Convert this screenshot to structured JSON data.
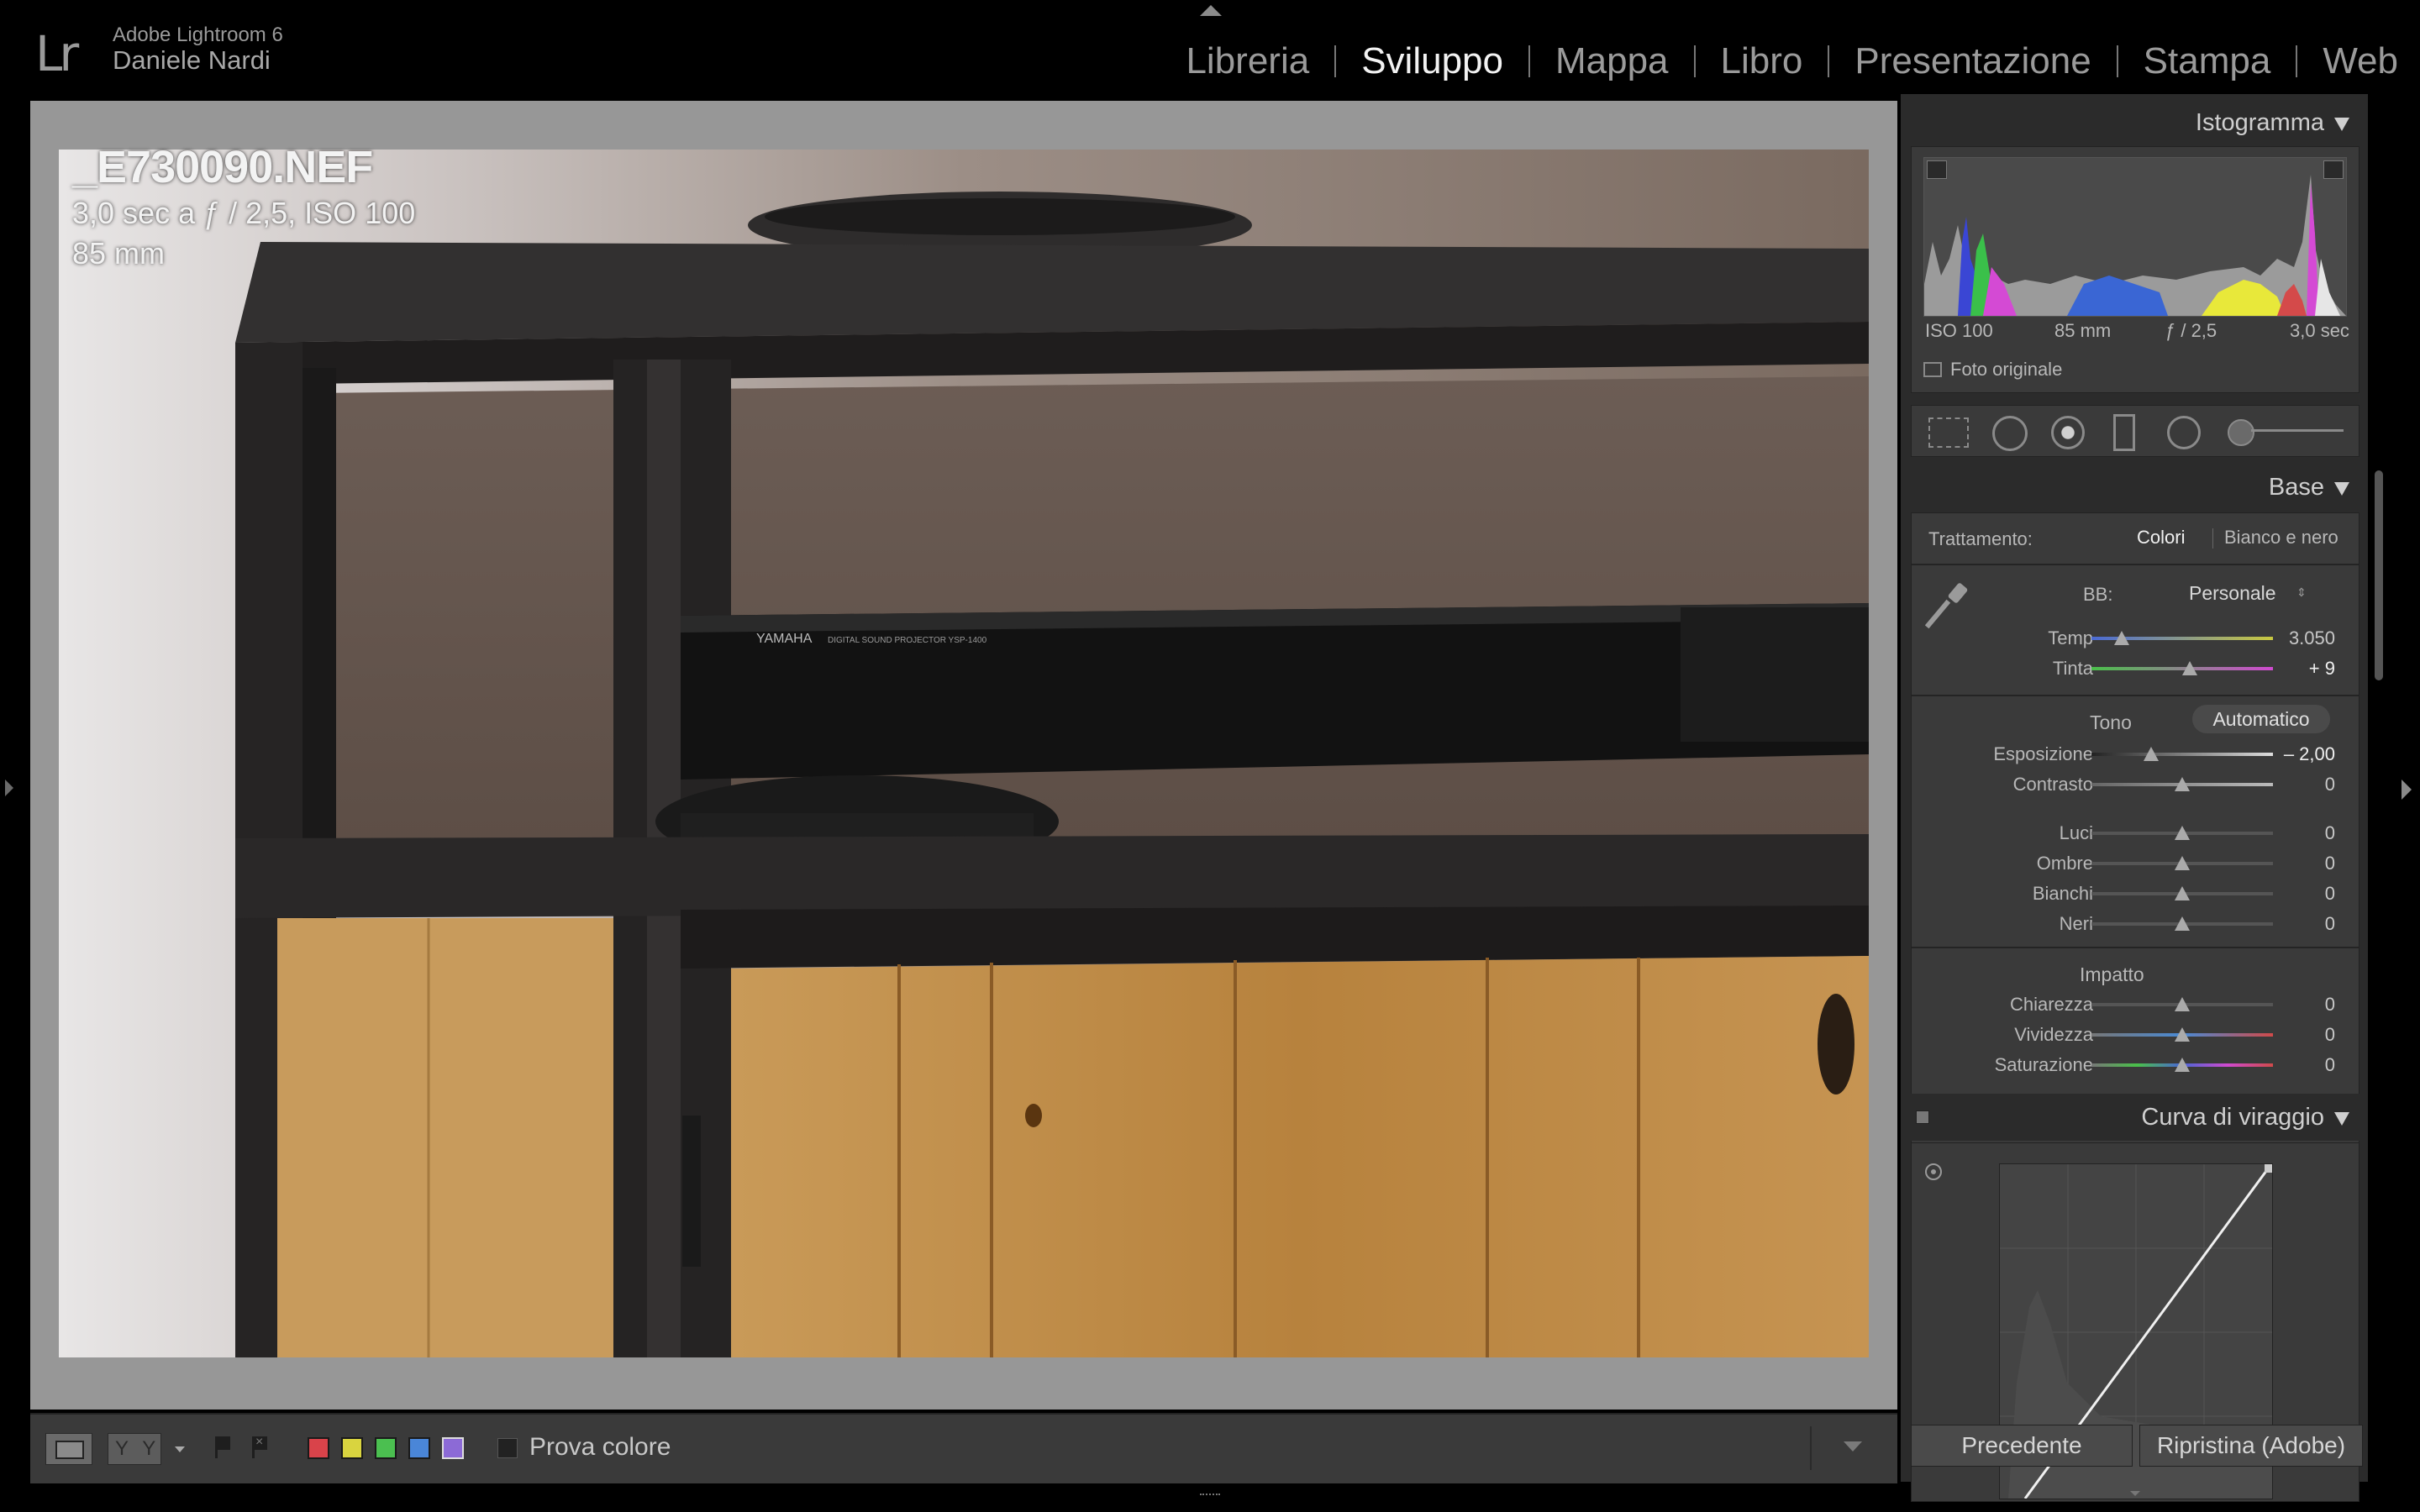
{
  "app": {
    "logo": "Lr",
    "title": "Adobe Lightroom 6",
    "user": "Daniele Nardi"
  },
  "modules": [
    {
      "label": "Libreria",
      "active": false
    },
    {
      "label": "Sviluppo",
      "active": true
    },
    {
      "label": "Mappa",
      "active": false
    },
    {
      "label": "Libro",
      "active": false
    },
    {
      "label": "Presentazione",
      "active": false
    },
    {
      "label": "Stampa",
      "active": false
    },
    {
      "label": "Web",
      "active": false
    }
  ],
  "photo": {
    "filename": "_E730090.NEF",
    "exposure_line": "3,0 sec a ƒ / 2,5, ISO 100",
    "focal_line": "85 mm",
    "device_brand": "YAMAHA",
    "device_model": "DIGITAL SOUND PROJECTOR  YSP-1400"
  },
  "histogram": {
    "title": "Istogramma",
    "iso": "ISO 100",
    "focal": "85 mm",
    "aperture": "ƒ / 2,5",
    "shutter": "3,0 sec",
    "original_label": "Foto originale"
  },
  "tools": [
    "crop-tool-icon",
    "spot-removal-icon",
    "red-eye-icon",
    "graduated-filter-icon",
    "radial-filter-icon",
    "adjustment-brush-icon"
  ],
  "base": {
    "title": "Base",
    "treatment_label": "Trattamento:",
    "treatment_color": "Colori",
    "treatment_bw": "Bianco e nero",
    "wb_label": "BB:",
    "wb_value": "Personale",
    "temp": {
      "label": "Temp",
      "value": "3.050",
      "pos": 0.15
    },
    "tint": {
      "label": "Tinta",
      "value": "+ 9",
      "pos": 0.53
    },
    "tone_label": "Tono",
    "auto_label": "Automatico",
    "exposure": {
      "label": "Esposizione",
      "value": "– 2,00",
      "pos": 0.33
    },
    "contrast": {
      "label": "Contrasto",
      "value": "0",
      "pos": 0.5
    },
    "highlights": {
      "label": "Luci",
      "value": "0",
      "pos": 0.5
    },
    "shadows": {
      "label": "Ombre",
      "value": "0",
      "pos": 0.5
    },
    "whites": {
      "label": "Bianchi",
      "value": "0",
      "pos": 0.5
    },
    "blacks": {
      "label": "Neri",
      "value": "0",
      "pos": 0.5
    },
    "presence_label": "Impatto",
    "clarity": {
      "label": "Chiarezza",
      "value": "0",
      "pos": 0.5
    },
    "vibrance": {
      "label": "Vividezza",
      "value": "0",
      "pos": 0.5
    },
    "saturation": {
      "label": "Saturazione",
      "value": "0",
      "pos": 0.5
    }
  },
  "curve": {
    "title": "Curva di viraggio"
  },
  "buttons": {
    "previous": "Precedente",
    "reset": "Ripristina (Adobe)"
  },
  "toolbar": {
    "proof_label": "Prova colore",
    "view_labels": [
      "Y",
      "Y"
    ],
    "color_labels": [
      "#d9434a",
      "#d9d43f",
      "#4bbf50",
      "#4a86d8",
      "#8c6ad6"
    ]
  }
}
